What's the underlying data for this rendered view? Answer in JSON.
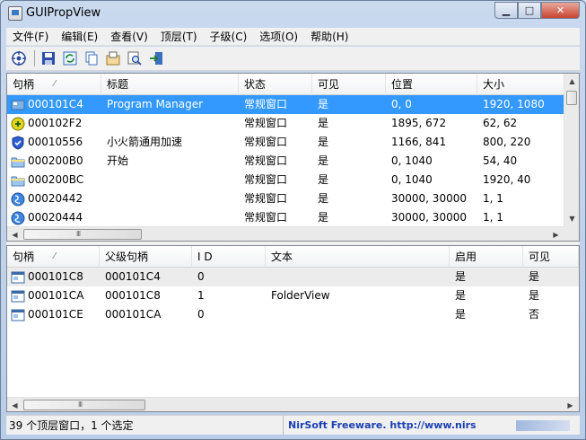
{
  "window": {
    "title": "GUIPropView"
  },
  "menu": [
    "文件(F)",
    "编辑(E)",
    "查看(V)",
    "顶层(T)",
    "子级(C)",
    "选项(O)",
    "帮助(H)"
  ],
  "toolbar": [
    "target-icon",
    "save-icon",
    "refresh-icon",
    "copy-icon",
    "properties-icon",
    "find-icon",
    "exit-icon"
  ],
  "top_table": {
    "columns": [
      "句柄",
      "标题",
      "状态",
      "可见",
      "位置",
      "大小"
    ],
    "rows": [
      {
        "icon": "desktop-icon",
        "handle": "000101C4",
        "title": "Program Manager",
        "state": "常规窗口",
        "visible": "是",
        "pos": "0, 0",
        "size": "1920, 1080",
        "selected": true
      },
      {
        "icon": "app-green-icon",
        "handle": "000102F2",
        "title": "",
        "state": "常规窗口",
        "visible": "是",
        "pos": "1895, 672",
        "size": "62, 62"
      },
      {
        "icon": "shield-icon",
        "handle": "00010556",
        "title": "小火箭通用加速",
        "state": "常规窗口",
        "visible": "是",
        "pos": "1166, 841",
        "size": "800, 220"
      },
      {
        "icon": "folder-icon",
        "handle": "000200B0",
        "title": "开始",
        "state": "常规窗口",
        "visible": "是",
        "pos": "0, 1040",
        "size": "54, 40"
      },
      {
        "icon": "folder-icon",
        "handle": "000200BC",
        "title": "",
        "state": "常规窗口",
        "visible": "是",
        "pos": "0, 1040",
        "size": "1920, 40"
      },
      {
        "icon": "globe-icon",
        "handle": "00020442",
        "title": "",
        "state": "常规窗口",
        "visible": "是",
        "pos": "30000, 30000",
        "size": "1, 1"
      },
      {
        "icon": "globe-icon",
        "handle": "00020444",
        "title": "",
        "state": "常规窗口",
        "visible": "是",
        "pos": "30000, 30000",
        "size": "1, 1"
      }
    ]
  },
  "bottom_table": {
    "columns": [
      "句柄",
      "父级句柄",
      "I D",
      "文本",
      "启用",
      "可见"
    ],
    "rows": [
      {
        "handle": "000101C8",
        "parent": "000101C4",
        "id": "0",
        "text": "",
        "enabled": "是",
        "visible": "是",
        "highlight": true
      },
      {
        "handle": "000101CA",
        "parent": "000101C8",
        "id": "1",
        "text": "FolderView",
        "enabled": "是",
        "visible": "是"
      },
      {
        "handle": "000101CE",
        "parent": "000101CA",
        "id": "0",
        "text": "",
        "enabled": "是",
        "visible": "否"
      }
    ]
  },
  "status": {
    "left": "39 个顶层窗口，1 个选定",
    "right": "NirSoft Freeware.  http://www.nirs"
  }
}
